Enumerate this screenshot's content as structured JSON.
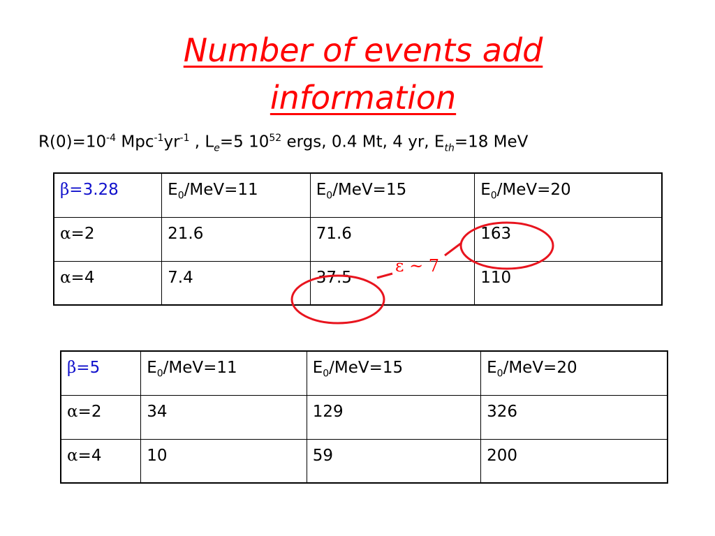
{
  "title": {
    "line1": "Number of events add",
    "line2": "information"
  },
  "params": {
    "r0": "R(0)=10",
    "r0_exp": "-4",
    "mpc": " Mpc",
    "mpc_exp": "-1",
    "yr": "yr",
    "yr_exp": "-1",
    "le_prefix": " , L",
    "le_sub": "e",
    "le_val": "=5 10",
    "le_exp": "52",
    "rest": " ergs, 0.4 Mt, 4 yr, E",
    "eth_sub": "th",
    "eth_val": "=18 MeV"
  },
  "table1": {
    "beta_symbol": "β",
    "beta_value": "=3.28",
    "columns": [
      "/MeV=11",
      "/MeV=15",
      "/MeV=20"
    ],
    "e_symbol": "E",
    "e_sub": "0",
    "rows": [
      {
        "alpha": "α",
        "alpha_value": "=2",
        "values": [
          "21.6",
          "71.6",
          "163"
        ]
      },
      {
        "alpha": "α",
        "alpha_value": "=4",
        "values": [
          "7.4",
          "37.5",
          "110"
        ]
      }
    ]
  },
  "table2": {
    "beta_symbol": "β",
    "beta_value": "=5",
    "columns": [
      "/MeV=11",
      "/MeV=15",
      "/MeV=20"
    ],
    "e_symbol": "E",
    "e_sub": "0",
    "rows": [
      {
        "alpha": "α",
        "alpha_value": "=2",
        "values": [
          "34",
          "129",
          "326"
        ]
      },
      {
        "alpha": "α",
        "alpha_value": "=4",
        "values": [
          "10",
          "59",
          "200"
        ]
      }
    ]
  },
  "annotation": {
    "label": "ε ~ 7",
    "color": "#ff0000"
  },
  "colors": {
    "title": "#ff0000",
    "beta": "#1010cc"
  }
}
